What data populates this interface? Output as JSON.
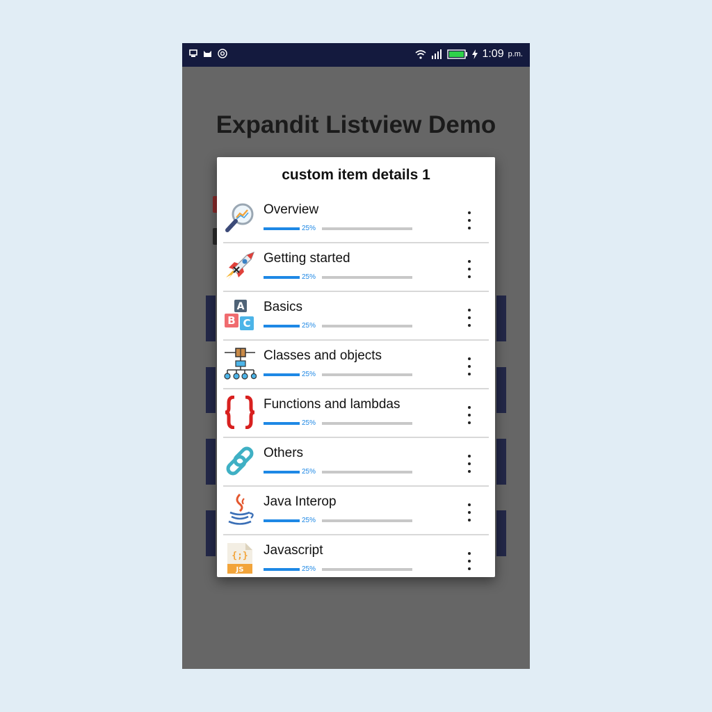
{
  "status_bar": {
    "time": "1:09",
    "ampm": "p.m."
  },
  "app": {
    "title": "Expandit Listview Demo"
  },
  "dialog": {
    "title": "custom item details 1",
    "items": [
      {
        "label": "Overview",
        "icon": "magnifier-chart-icon",
        "progress_label": "25%",
        "progress": 0.25
      },
      {
        "label": "Getting started",
        "icon": "rocket-icon",
        "progress_label": "25%",
        "progress": 0.25
      },
      {
        "label": "Basics",
        "icon": "abc-blocks-icon",
        "progress_label": "25%",
        "progress": 0.25
      },
      {
        "label": "Classes and objects",
        "icon": "class-hierarchy-icon",
        "progress_label": "25%",
        "progress": 0.25
      },
      {
        "label": "Functions and lambdas",
        "icon": "curly-braces-icon",
        "progress_label": "25%",
        "progress": 0.25
      },
      {
        "label": "Others",
        "icon": "chain-link-icon",
        "progress_label": "25%",
        "progress": 0.25
      },
      {
        "label": "Java Interop",
        "icon": "java-cup-icon",
        "progress_label": "25%",
        "progress": 0.25
      },
      {
        "label": "Javascript",
        "icon": "js-file-icon",
        "progress_label": "25%",
        "progress": 0.25
      }
    ]
  },
  "colors": {
    "status_bar": "#141a3e",
    "backdrop": "#666666",
    "progress_fill": "#1e88e5",
    "progress_track": "#c8c8c8",
    "page_background": "#e1edf5"
  }
}
